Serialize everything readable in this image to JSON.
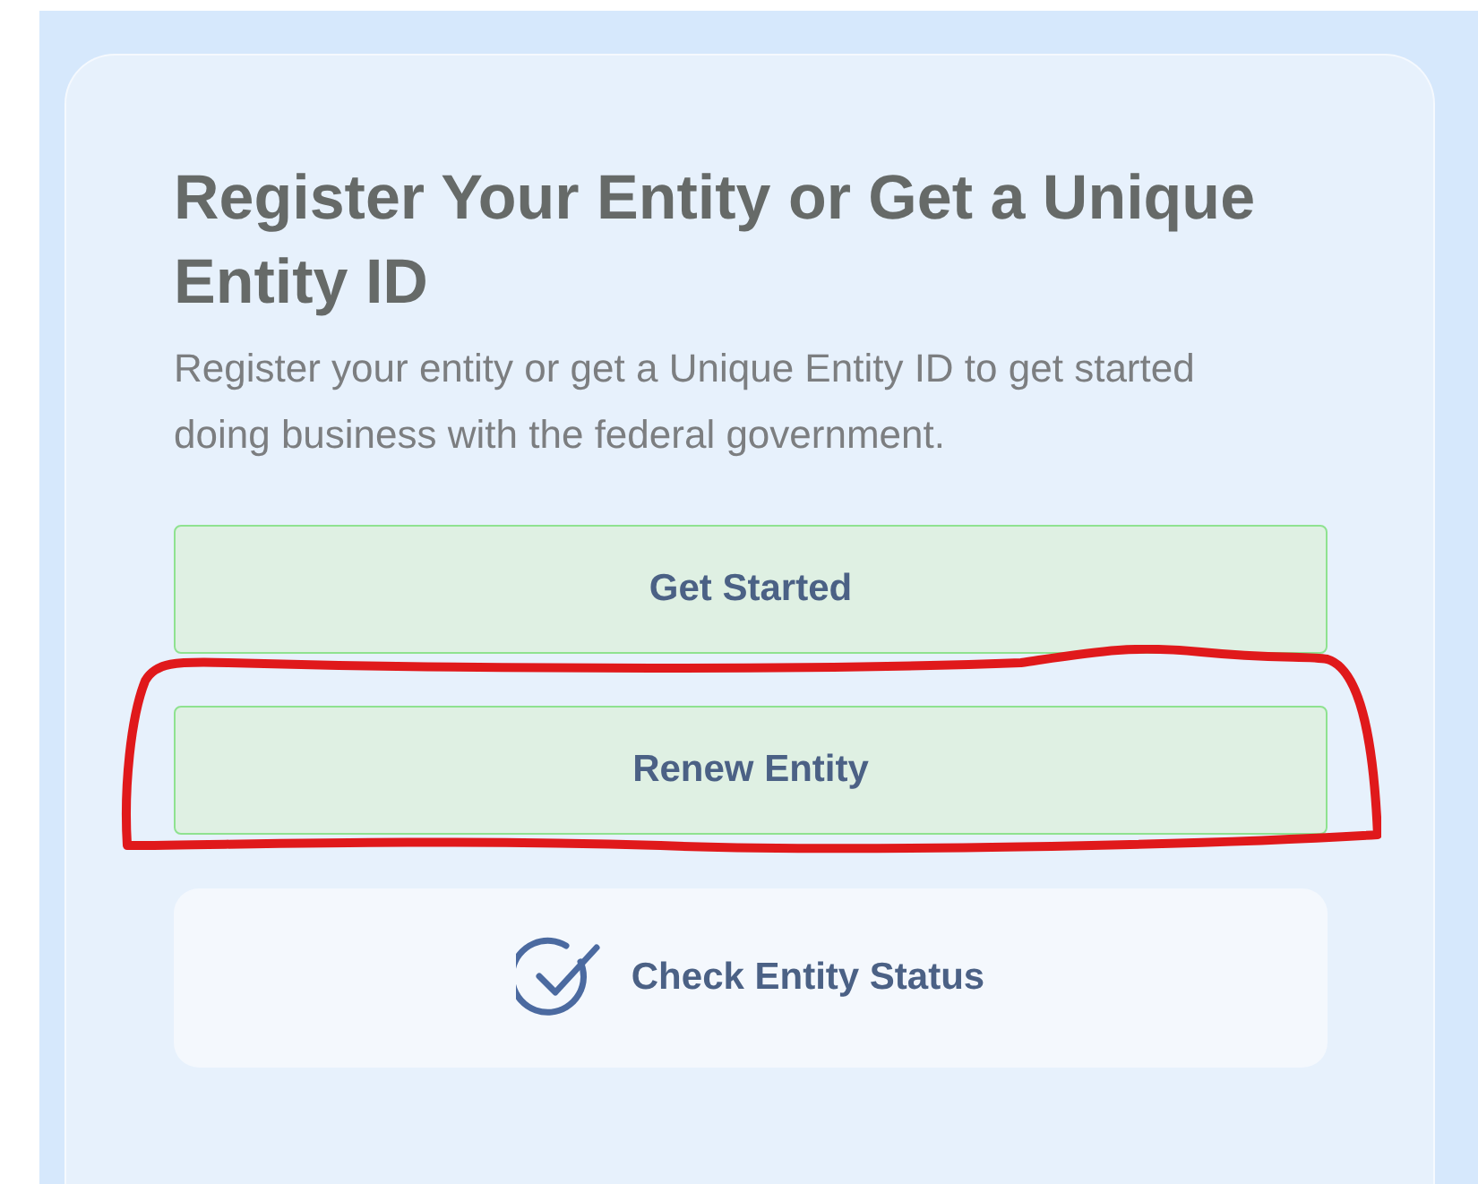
{
  "card": {
    "title": "Register Your Entity or Get a Unique Entity ID",
    "description": "Register your entity or get a Unique Entity ID to get started doing business with the federal government.",
    "actions": [
      {
        "kind": "primary",
        "label": "Get Started",
        "highlighted": false
      },
      {
        "kind": "primary",
        "label": "Renew Entity",
        "highlighted": true
      },
      {
        "kind": "status",
        "label": "Check Entity Status",
        "highlighted": false
      }
    ]
  }
}
